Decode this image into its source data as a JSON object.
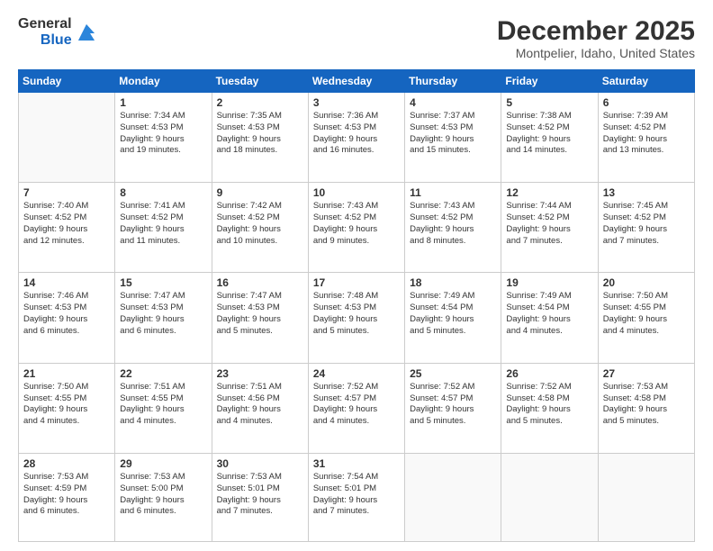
{
  "logo": {
    "general": "General",
    "blue": "Blue"
  },
  "header": {
    "title": "December 2025",
    "subtitle": "Montpelier, Idaho, United States"
  },
  "weekdays": [
    "Sunday",
    "Monday",
    "Tuesday",
    "Wednesday",
    "Thursday",
    "Friday",
    "Saturday"
  ],
  "weeks": [
    [
      {
        "day": "",
        "info": ""
      },
      {
        "day": "1",
        "info": "Sunrise: 7:34 AM\nSunset: 4:53 PM\nDaylight: 9 hours\nand 19 minutes."
      },
      {
        "day": "2",
        "info": "Sunrise: 7:35 AM\nSunset: 4:53 PM\nDaylight: 9 hours\nand 18 minutes."
      },
      {
        "day": "3",
        "info": "Sunrise: 7:36 AM\nSunset: 4:53 PM\nDaylight: 9 hours\nand 16 minutes."
      },
      {
        "day": "4",
        "info": "Sunrise: 7:37 AM\nSunset: 4:53 PM\nDaylight: 9 hours\nand 15 minutes."
      },
      {
        "day": "5",
        "info": "Sunrise: 7:38 AM\nSunset: 4:52 PM\nDaylight: 9 hours\nand 14 minutes."
      },
      {
        "day": "6",
        "info": "Sunrise: 7:39 AM\nSunset: 4:52 PM\nDaylight: 9 hours\nand 13 minutes."
      }
    ],
    [
      {
        "day": "7",
        "info": "Sunrise: 7:40 AM\nSunset: 4:52 PM\nDaylight: 9 hours\nand 12 minutes."
      },
      {
        "day": "8",
        "info": "Sunrise: 7:41 AM\nSunset: 4:52 PM\nDaylight: 9 hours\nand 11 minutes."
      },
      {
        "day": "9",
        "info": "Sunrise: 7:42 AM\nSunset: 4:52 PM\nDaylight: 9 hours\nand 10 minutes."
      },
      {
        "day": "10",
        "info": "Sunrise: 7:43 AM\nSunset: 4:52 PM\nDaylight: 9 hours\nand 9 minutes."
      },
      {
        "day": "11",
        "info": "Sunrise: 7:43 AM\nSunset: 4:52 PM\nDaylight: 9 hours\nand 8 minutes."
      },
      {
        "day": "12",
        "info": "Sunrise: 7:44 AM\nSunset: 4:52 PM\nDaylight: 9 hours\nand 7 minutes."
      },
      {
        "day": "13",
        "info": "Sunrise: 7:45 AM\nSunset: 4:52 PM\nDaylight: 9 hours\nand 7 minutes."
      }
    ],
    [
      {
        "day": "14",
        "info": "Sunrise: 7:46 AM\nSunset: 4:53 PM\nDaylight: 9 hours\nand 6 minutes."
      },
      {
        "day": "15",
        "info": "Sunrise: 7:47 AM\nSunset: 4:53 PM\nDaylight: 9 hours\nand 6 minutes."
      },
      {
        "day": "16",
        "info": "Sunrise: 7:47 AM\nSunset: 4:53 PM\nDaylight: 9 hours\nand 5 minutes."
      },
      {
        "day": "17",
        "info": "Sunrise: 7:48 AM\nSunset: 4:53 PM\nDaylight: 9 hours\nand 5 minutes."
      },
      {
        "day": "18",
        "info": "Sunrise: 7:49 AM\nSunset: 4:54 PM\nDaylight: 9 hours\nand 5 minutes."
      },
      {
        "day": "19",
        "info": "Sunrise: 7:49 AM\nSunset: 4:54 PM\nDaylight: 9 hours\nand 4 minutes."
      },
      {
        "day": "20",
        "info": "Sunrise: 7:50 AM\nSunset: 4:55 PM\nDaylight: 9 hours\nand 4 minutes."
      }
    ],
    [
      {
        "day": "21",
        "info": "Sunrise: 7:50 AM\nSunset: 4:55 PM\nDaylight: 9 hours\nand 4 minutes."
      },
      {
        "day": "22",
        "info": "Sunrise: 7:51 AM\nSunset: 4:55 PM\nDaylight: 9 hours\nand 4 minutes."
      },
      {
        "day": "23",
        "info": "Sunrise: 7:51 AM\nSunset: 4:56 PM\nDaylight: 9 hours\nand 4 minutes."
      },
      {
        "day": "24",
        "info": "Sunrise: 7:52 AM\nSunset: 4:57 PM\nDaylight: 9 hours\nand 4 minutes."
      },
      {
        "day": "25",
        "info": "Sunrise: 7:52 AM\nSunset: 4:57 PM\nDaylight: 9 hours\nand 5 minutes."
      },
      {
        "day": "26",
        "info": "Sunrise: 7:52 AM\nSunset: 4:58 PM\nDaylight: 9 hours\nand 5 minutes."
      },
      {
        "day": "27",
        "info": "Sunrise: 7:53 AM\nSunset: 4:58 PM\nDaylight: 9 hours\nand 5 minutes."
      }
    ],
    [
      {
        "day": "28",
        "info": "Sunrise: 7:53 AM\nSunset: 4:59 PM\nDaylight: 9 hours\nand 6 minutes."
      },
      {
        "day": "29",
        "info": "Sunrise: 7:53 AM\nSunset: 5:00 PM\nDaylight: 9 hours\nand 6 minutes."
      },
      {
        "day": "30",
        "info": "Sunrise: 7:53 AM\nSunset: 5:01 PM\nDaylight: 9 hours\nand 7 minutes."
      },
      {
        "day": "31",
        "info": "Sunrise: 7:54 AM\nSunset: 5:01 PM\nDaylight: 9 hours\nand 7 minutes."
      },
      {
        "day": "",
        "info": ""
      },
      {
        "day": "",
        "info": ""
      },
      {
        "day": "",
        "info": ""
      }
    ]
  ]
}
